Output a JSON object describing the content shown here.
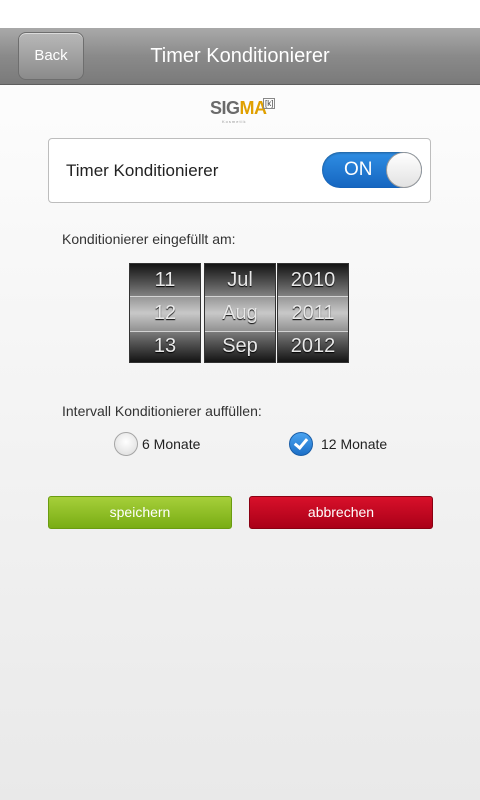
{
  "header": {
    "back_label": "Back",
    "title": "Timer Konditionierer"
  },
  "logo": {
    "text_start": "SIG",
    "text_accent": "MA",
    "superscript": "[k]",
    "tagline": "Kosmetik"
  },
  "timer_card": {
    "label": "Timer Konditionierer",
    "toggle_label": "ON",
    "toggle_on": true,
    "toggle_color": "#1e78d8"
  },
  "date_section": {
    "label": "Konditionierer eingefüllt am:",
    "day": {
      "above": "11",
      "selected": "12",
      "below": "13"
    },
    "month": {
      "above": "Jul",
      "selected": "Aug",
      "below": "Sep"
    },
    "year": {
      "above": "2010",
      "selected": "2011",
      "below": "2012"
    }
  },
  "interval_section": {
    "label": "Intervall Konditionierer auffüllen:",
    "options": [
      {
        "label": "6 Monate",
        "checked": false
      },
      {
        "label": "12 Monate",
        "checked": true
      }
    ]
  },
  "actions": {
    "save_label": "speichern",
    "save_color": "#8bbf22",
    "cancel_label": "abbrechen",
    "cancel_color": "#c0001f"
  }
}
